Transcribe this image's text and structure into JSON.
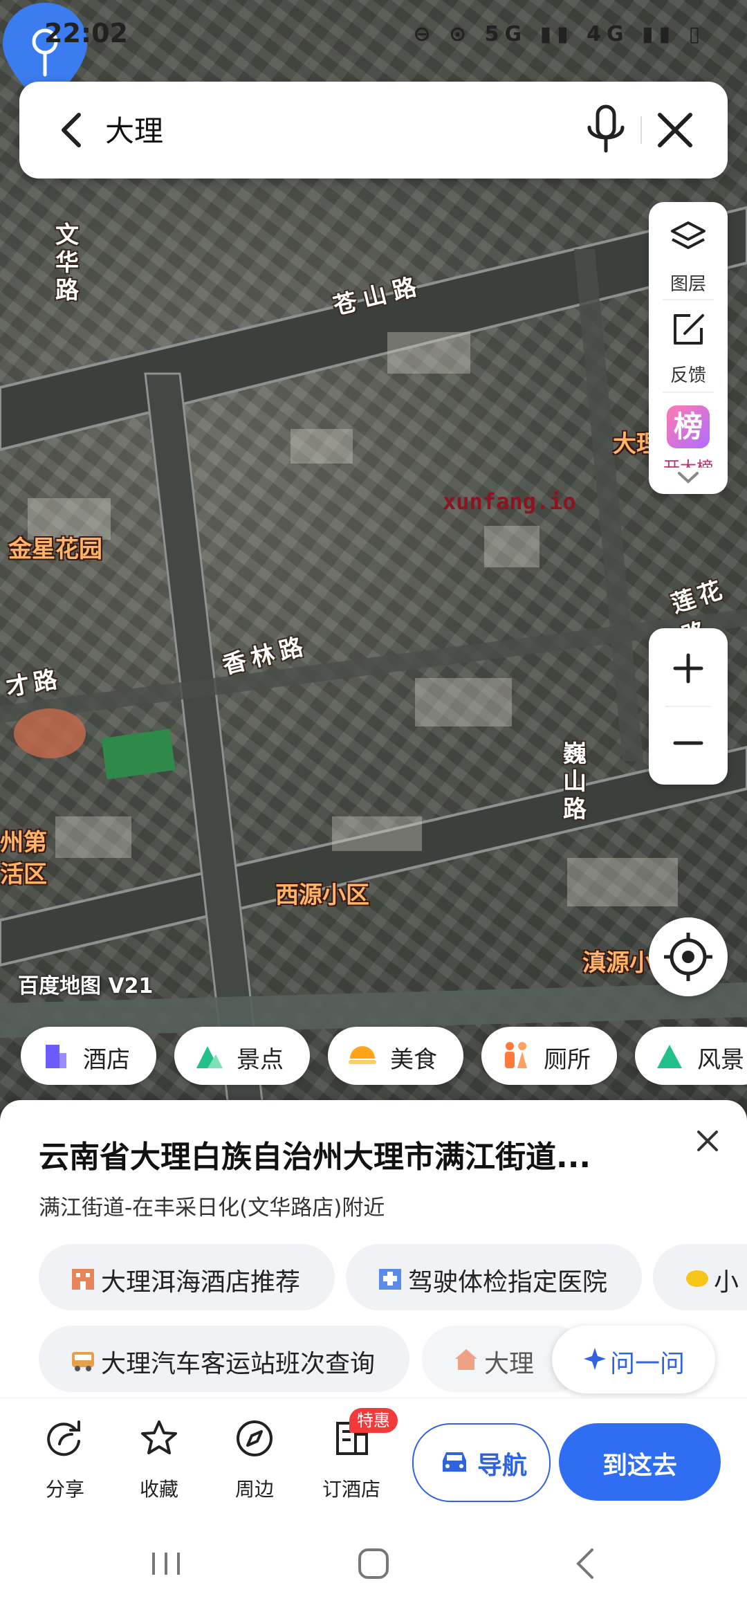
{
  "status_bar": {
    "time": "22:02",
    "icons": "⊖ ⊙ 5G ▮▮ 4G ▮▮ ▯"
  },
  "search": {
    "query": "大理"
  },
  "tools": {
    "layers_label": "图层",
    "feedback_label": "反馈",
    "rank_icon_char": "榜",
    "rank_label": "开大榜"
  },
  "map": {
    "roads": [
      "文华路",
      "苍山路",
      "香林路",
      "巍山路",
      "莲花路",
      "才路"
    ],
    "pois": [
      "金星花园",
      "西源小区",
      "滇源小",
      "大理",
      "州第",
      "活区"
    ],
    "watermark": "xunfang.io",
    "brand": "百度地图 V21"
  },
  "categories": [
    {
      "label": "酒店",
      "icon": "hotel-icon",
      "color": "#6a5cff"
    },
    {
      "label": "景点",
      "icon": "scenic-icon",
      "color": "#22c08a"
    },
    {
      "label": "美食",
      "icon": "food-icon",
      "color": "#ffa31a"
    },
    {
      "label": "厕所",
      "icon": "toilet-icon",
      "color": "#ff7a3a"
    },
    {
      "label": "风景",
      "icon": "scenery-icon",
      "color": "#22c08a"
    }
  ],
  "place": {
    "title": "云南省大理白族自治州大理市满江街道...",
    "subtitle": "满江街道-在丰采日化(文华路店)附近"
  },
  "suggestions": [
    {
      "label": "大理洱海酒店推荐",
      "icon": "hotel-building-icon"
    },
    {
      "label": "驾驶体检指定医院",
      "icon": "hospital-icon"
    },
    {
      "label": "小",
      "icon": "lemon-icon"
    },
    {
      "label": "大理汽车客运站班次查询",
      "icon": "bus-icon"
    },
    {
      "label": "大理",
      "icon": "house-icon"
    }
  ],
  "ask": {
    "label": "问一问"
  },
  "actions": {
    "share": "分享",
    "favorite": "收藏",
    "nearby": "周边",
    "book_hotel": "订酒店",
    "deal_badge": "特惠",
    "navigate": "导航",
    "go_here": "到这去"
  },
  "colors": {
    "accent": "#2f6ef2",
    "pin": "#3b7cf0"
  }
}
